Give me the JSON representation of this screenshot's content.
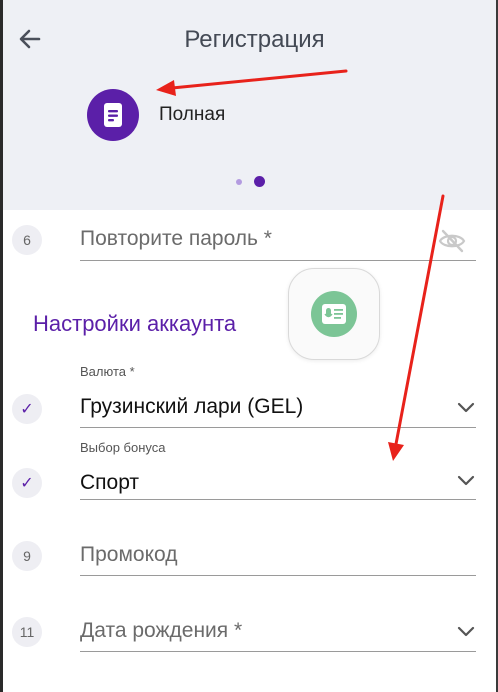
{
  "header": {
    "title": "Регистрация",
    "registration_type": "Полная",
    "icons": {
      "back": "arrow-left-icon",
      "type": "document-icon"
    },
    "colors": {
      "accent": "#5b1fa8",
      "background": "#eef0f5"
    }
  },
  "form": {
    "repeat_password": {
      "step": "6",
      "placeholder": "Повторите пароль *",
      "icon": "eye-off-icon"
    },
    "account_settings": {
      "title": "Настройки аккаунта"
    },
    "currency": {
      "label": "Валюта *",
      "value": "Грузинский лари (GEL)",
      "status_icon": "check-icon"
    },
    "bonus": {
      "label": "Выбор бонуса",
      "value": "Спорт",
      "status_icon": "check-icon"
    },
    "promo": {
      "step": "9",
      "placeholder": "Промокод"
    },
    "birthdate": {
      "step": "11",
      "placeholder": "Дата рождения *"
    }
  },
  "overlay": {
    "icon": "voice-assistant-icon",
    "color": "#7cc596"
  },
  "annotations": {
    "arrow_color": "#e8221b"
  }
}
